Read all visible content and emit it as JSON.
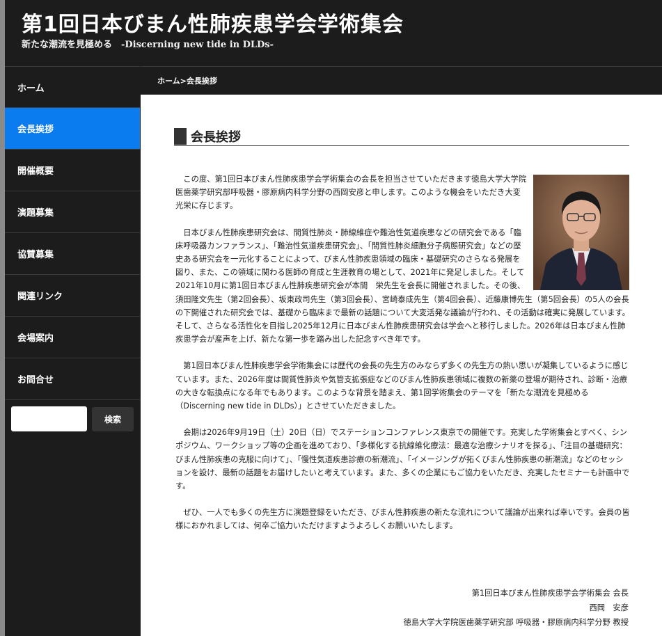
{
  "header": {
    "title": "第1回日本びまん性肺疾患学会学術集会",
    "tagline": "新たな潮流を見極める　-Discerning new tide in DLDs-"
  },
  "nav": {
    "items": [
      {
        "label": "ホーム",
        "active": false
      },
      {
        "label": "会長挨拶",
        "active": true
      },
      {
        "label": "開催概要",
        "active": false
      },
      {
        "label": "演題募集",
        "active": false
      },
      {
        "label": "協賛募集",
        "active": false
      },
      {
        "label": "関連リンク",
        "active": false
      },
      {
        "label": "会場案内",
        "active": false
      },
      {
        "label": "お問合せ",
        "active": false
      }
    ],
    "search": {
      "value": "",
      "placeholder": "",
      "button_label": "検索"
    }
  },
  "breadcrumb": "ホーム>会長挨拶",
  "page": {
    "heading": "会長挨拶",
    "paragraphs": [
      "この度、第1回日本びまん性肺疾患学会学術集会の会長を担当させていただきます徳島大学大学院医歯薬学研究部呼吸器・膠原病内科学分野の西岡安彦と申します。このような機会をいただき大変光栄に存じます。",
      "日本びまん性肺疾患研究会は、間質性肺炎・肺線維症や難治性気道疾患などの研究会である「臨床呼吸器カンファランス」、「難治性気道疾患研究会」、「間質性肺炎細胞分子病態研究会」などの歴史ある研究会を一元化することによって、びまん性肺疾患領域の臨床・基礎研究のさらなる発展を図り、また、この領域に関わる医師の育成と生涯教育の場として、2021年に発足しました。そして2021年10月に第1回日本びまん性肺疾患研究会が本間　栄先生を会長に開催されました。その後、須田隆文先生（第2回会長）、坂東政司先生（第3回会長）、宮崎泰成先生（第4回会長）、近藤康博先生（第5回会長）の5人の会長の下開催された研究会では、基礎から臨床まで最新の話題について大変活発な議論が行われ、その活動は確実に発展しています。そして、さらなる活性化を目指し2025年12月に日本びまん性肺疾患研究会は学会へと移行しました。2026年は日本びまん性肺疾患学会が産声を上げ、新たな第一歩を踏み出した記念すべき年です。",
      "第1回日本びまん性肺疾患学会学術集会には歴代の会長の先生方のみならず多くの先生方の熱い思いが凝集しているように感じています。また、2026年度は間質性肺炎や気管支拡張症などのびまん性肺疾患領域に複数の新薬の登場が期待され、診断・治療の大きな転換点になる年でもあります。このような背景を踏まえ、第1回学術集会のテーマを「新たな潮流を見極める（Discerning new tide in DLDs）」とさせていただきました。",
      "会期は2026年9月19日（土）20日（日）でステーションコンファレンス東京での開催です。充実した学術集会とすべく、シンポジウム、ワークショップ等の企画を進めており、「多様化する抗線維化療法：最適な治療シナリオを探る」、「注目の基礎研究：びまん性肺疾患の克服に向けて」、「慢性気道疾患診療の新潮流」、「イメージングが拓くびまん性肺疾患の新潮流」などのセッションを設け、最新の話題をお届けしたいと考えています。また、多くの企業にもご協力をいただき、充実したセミナーも計画中です。",
      "ぜひ、一人でも多くの先生方に演題登録をいただき、びまん性肺疾患の新たな流れについて議論が出来れば幸いです。会員の皆様におかれましては、何卒ご協力いただけますようよろしくお願いいたします。"
    ],
    "signature": [
      "第1回日本びまん性肺疾患学会学術集会 会長",
      "西岡　安彦",
      "徳島大学大学院医歯薬学研究部 呼吸器・膠原病内科学分野 教授"
    ]
  },
  "colors": {
    "accent": "#0a7cf0",
    "dark": "#1c1c1c"
  }
}
